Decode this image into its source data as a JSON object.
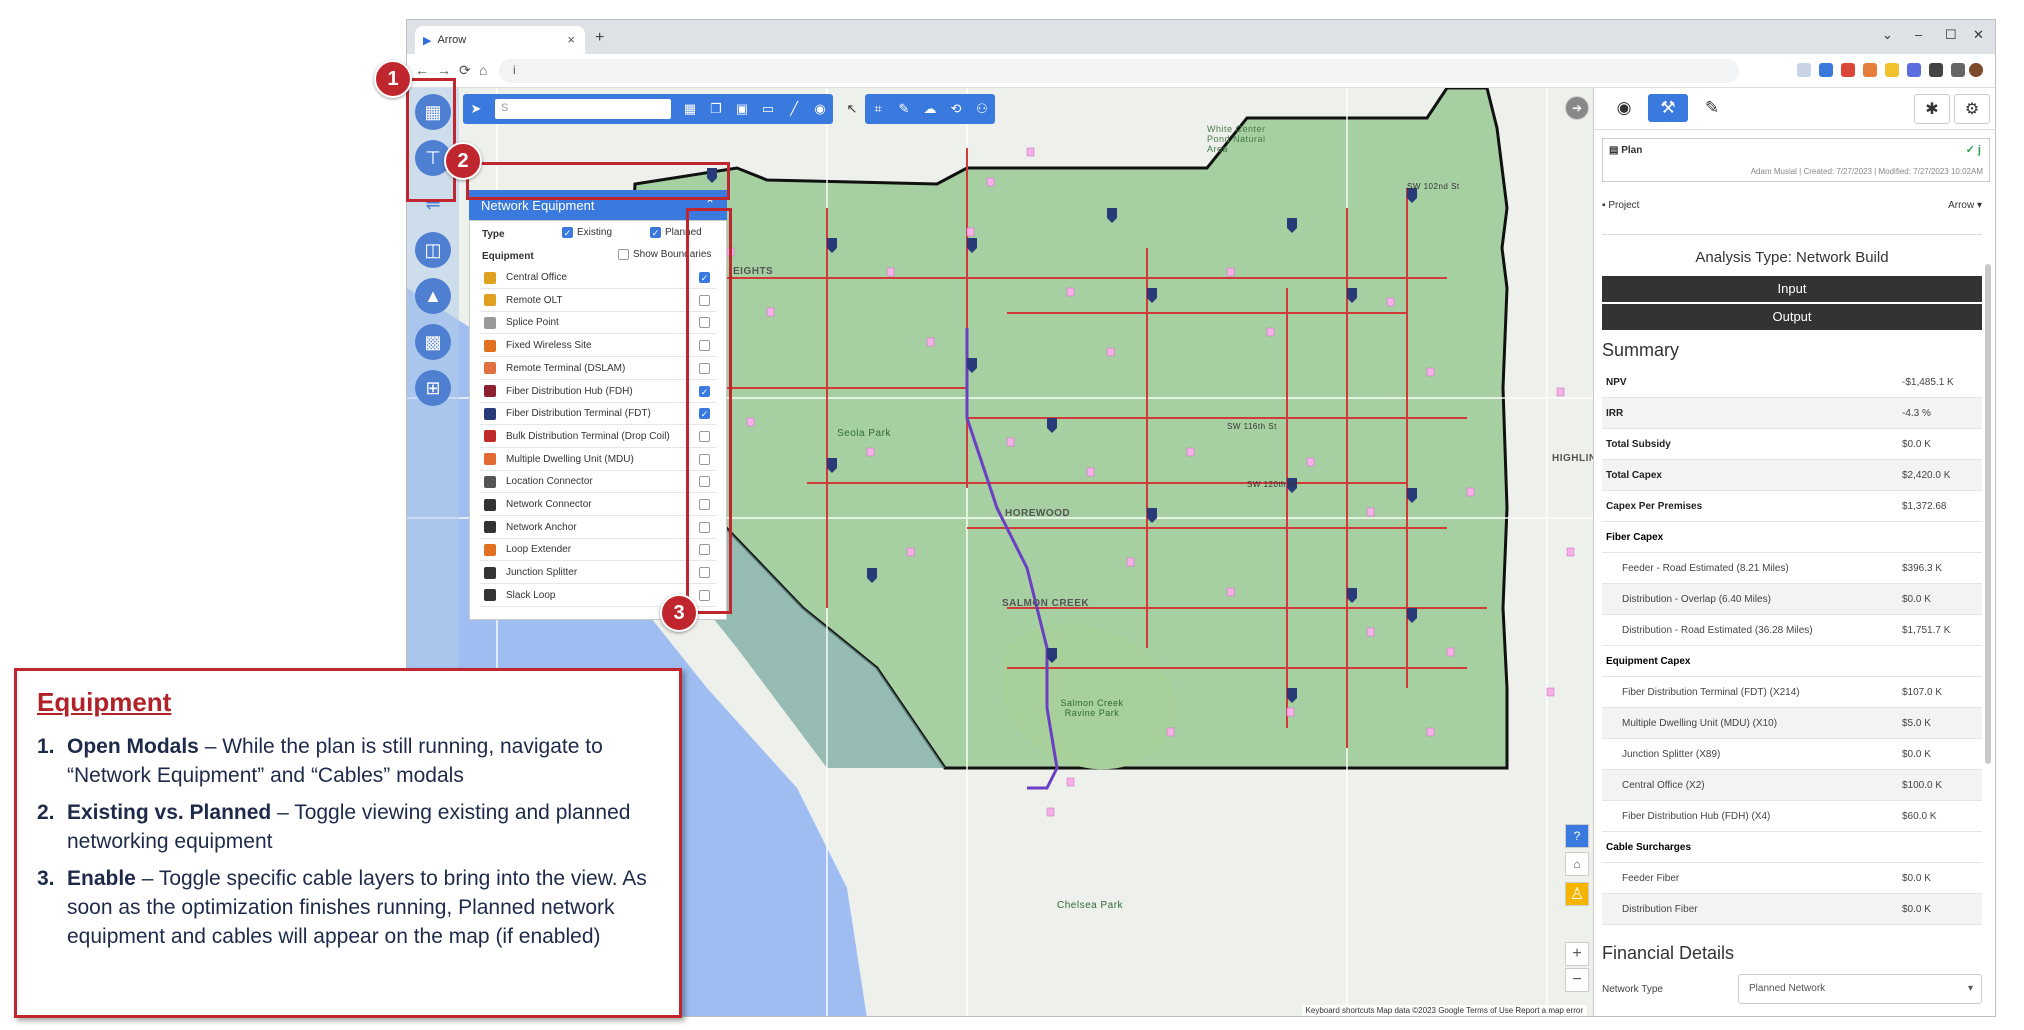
{
  "browser": {
    "tab_title": "Arrow",
    "url": "i",
    "new_tab": "+",
    "win_min": "–",
    "win_max": "☐",
    "win_close": "✕",
    "win_menu": "⌄"
  },
  "toolbar": {
    "search_placeholder": "S"
  },
  "network_equipment": {
    "title": "Network Equipment",
    "type_label": "Type",
    "existing_label": "Existing",
    "planned_label": "Planned",
    "equipment_label": "Equipment",
    "show_boundaries_label": "Show Boundaries",
    "items": [
      {
        "label": "Central Office",
        "checked": true,
        "color": "#e0a020"
      },
      {
        "label": "Remote OLT",
        "checked": false,
        "color": "#e0a020"
      },
      {
        "label": "Splice Point",
        "checked": false,
        "color": "#999999"
      },
      {
        "label": "Fixed Wireless Site",
        "checked": false,
        "color": "#e07020"
      },
      {
        "label": "Remote Terminal (DSLAM)",
        "checked": false,
        "color": "#e07040"
      },
      {
        "label": "Fiber Distribution Hub (FDH)",
        "checked": true,
        "color": "#8a2030"
      },
      {
        "label": "Fiber Distribution Terminal (FDT)",
        "checked": true,
        "color": "#283a78"
      },
      {
        "label": "Bulk Distribution Terminal (Drop Coil)",
        "checked": false,
        "color": "#c02a2a"
      },
      {
        "label": "Multiple Dwelling Unit (MDU)",
        "checked": false,
        "color": "#e06a30"
      },
      {
        "label": "Location Connector",
        "checked": false,
        "color": "#555555"
      },
      {
        "label": "Network Connector",
        "checked": false,
        "color": "#333333"
      },
      {
        "label": "Network Anchor",
        "checked": false,
        "color": "#333333"
      },
      {
        "label": "Loop Extender",
        "checked": false,
        "color": "#e07020"
      },
      {
        "label": "Junction Splitter",
        "checked": false,
        "color": "#333333"
      },
      {
        "label": "Slack Loop",
        "checked": false,
        "color": "#333333"
      }
    ]
  },
  "badges": {
    "one": "1",
    "two": "2",
    "three": "3"
  },
  "map_labels": {
    "salmon_creek": "SALMON CREEK",
    "shorewood": "HOREWOOD",
    "highlin": "HIGHLIN",
    "heights": "EIGHTS",
    "white_center": "White Center Pond Natural Area",
    "seola_park": "Seola Park",
    "salmon_creek_park": "Salmon Creek Ravine Park",
    "chelsea_park": "Chelsea Park",
    "sw_116th": "SW 116th St",
    "sw_120th": "SW 120th St",
    "sw_102nd": "SW 102nd St",
    "attribution": "Keyboard shortcuts   Map data ©2023 Google   Terms of Use   Report a map error"
  },
  "right_panel": {
    "plan_label": "Plan",
    "plan_check": "✓ j",
    "plan_meta": "Adam Musial | Created: 7/27/2023 | Modified: 7/27/2023 10:02AM",
    "project_label": "Project",
    "project_value": "Arrow",
    "analysis_title": "Analysis Type: Network Build",
    "input_btn": "Input",
    "output_btn": "Output",
    "summary_title": "Summary",
    "rows": [
      {
        "k": "NPV",
        "v": "-$1,485.1 K",
        "style": "bold"
      },
      {
        "k": "IRR",
        "v": "-4.3 %",
        "style": "bold"
      },
      {
        "k": "Total Subsidy",
        "v": "$0.0 K",
        "style": "bold"
      },
      {
        "k": "Total Capex",
        "v": "$2,420.0 K",
        "style": "bold"
      },
      {
        "k": "Capex Per Premises",
        "v": "$1,372.68",
        "style": "bold"
      },
      {
        "k": "Fiber Capex",
        "v": "",
        "style": "head"
      },
      {
        "k": "Feeder - Road Estimated (8.21 Miles)",
        "v": "$396.3 K",
        "style": "sub"
      },
      {
        "k": "Distribution - Overlap (6.40 Miles)",
        "v": "$0.0 K",
        "style": "sub"
      },
      {
        "k": "Distribution - Road Estimated (36.28 Miles)",
        "v": "$1,751.7 K",
        "style": "sub"
      },
      {
        "k": "Equipment Capex",
        "v": "",
        "style": "head"
      },
      {
        "k": "Fiber Distribution Terminal (FDT) (X214)",
        "v": "$107.0 K",
        "style": "sub"
      },
      {
        "k": "Multiple Dwelling Unit (MDU) (X10)",
        "v": "$5.0 K",
        "style": "sub"
      },
      {
        "k": "Junction Splitter (X89)",
        "v": "$0.0 K",
        "style": "sub"
      },
      {
        "k": "Central Office (X2)",
        "v": "$100.0 K",
        "style": "sub"
      },
      {
        "k": "Fiber Distribution Hub (FDH) (X4)",
        "v": "$60.0 K",
        "style": "sub"
      },
      {
        "k": "Cable Surcharges",
        "v": "",
        "style": "head"
      },
      {
        "k": "Feeder Fiber",
        "v": "$0.0 K",
        "style": "sub"
      },
      {
        "k": "Distribution Fiber",
        "v": "$0.0 K",
        "style": "sub"
      }
    ],
    "financial_title": "Financial Details",
    "network_type_label": "Network Type",
    "network_type_value": "Planned Network"
  },
  "instructions": {
    "title": "Equipment",
    "items": [
      {
        "num": "1.",
        "bold": "Open Modals",
        "text": " – While the plan is still running, navigate to “Network Equipment”  and “Cables” modals"
      },
      {
        "num": "2.",
        "bold": "Existing vs. Planned",
        "text": " – Toggle viewing existing and planned networking equipment"
      },
      {
        "num": "3.",
        "bold": "Enable",
        "text": " – Toggle specific cable layers to bring into the view. As soon as the optimization finishes running, Planned network equipment and cables will appear on the map (if enabled)"
      }
    ]
  },
  "colors": {
    "accent": "#3a79de",
    "annotation_red": "#c0262d",
    "area_green": "#8fc58a",
    "water": "#9fbdf0",
    "fiber_red": "#d23a3a"
  }
}
